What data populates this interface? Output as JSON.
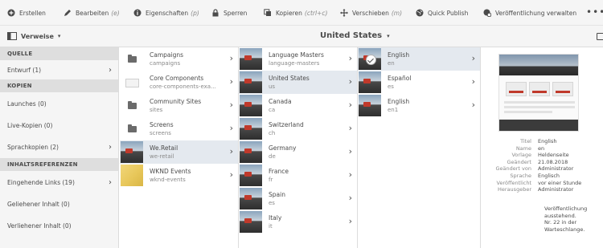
{
  "actions": [
    {
      "name": "create-action",
      "icon": "add-icon",
      "label": "Erstellen",
      "shortcut": ""
    },
    {
      "name": "edit-action",
      "icon": "pencil-icon",
      "label": "Bearbeiten",
      "shortcut": "(e)"
    },
    {
      "name": "properties-action",
      "icon": "info-icon",
      "label": "Eigenschaften",
      "shortcut": "(p)"
    },
    {
      "name": "lock-action",
      "icon": "lock-icon",
      "label": "Sperren",
      "shortcut": ""
    },
    {
      "name": "copy-action",
      "icon": "copy-icon",
      "label": "Kopieren",
      "shortcut": "(ctrl+c)"
    },
    {
      "name": "move-action",
      "icon": "move-icon",
      "label": "Verschieben",
      "shortcut": "(m)"
    },
    {
      "name": "quick-publish-action",
      "icon": "globe-icon",
      "label": "Quick Publish",
      "shortcut": ""
    },
    {
      "name": "manage-publication-action",
      "icon": "globe-gear-icon",
      "label": "Veröffentlichung verwalten",
      "shortcut": ""
    }
  ],
  "titlebar": {
    "rail_label": "Verweise",
    "title": "United States"
  },
  "rail": {
    "sections": [
      {
        "header": "QUELLE",
        "items": [
          {
            "label": "Entwurf (1)",
            "arrow": true
          }
        ]
      },
      {
        "header": "KOPIEN",
        "items": [
          {
            "label": "Launches (0)",
            "arrow": false
          },
          {
            "label": "Live-Kopien (0)",
            "arrow": false
          },
          {
            "label": "Sprachkopien (2)",
            "arrow": true
          }
        ]
      },
      {
        "header": "INHALTSREFERENZEN",
        "items": [
          {
            "label": "Eingehende Links (19)",
            "arrow": true
          },
          {
            "label": "Geliehener Inhalt (0)",
            "arrow": false
          },
          {
            "label": "Verliehener Inhalt (0)",
            "arrow": false
          }
        ]
      }
    ]
  },
  "columns": [
    [
      {
        "title": "Campaigns",
        "sub": "campaigns",
        "thumb": "folder",
        "selected": false
      },
      {
        "title": "Core Components",
        "sub": "core-components-exa...",
        "thumb": "component",
        "selected": false
      },
      {
        "title": "Community Sites",
        "sub": "sites",
        "thumb": "folder",
        "selected": false
      },
      {
        "title": "Screens",
        "sub": "screens",
        "thumb": "folder",
        "selected": false
      },
      {
        "title": "We.Retail",
        "sub": "we-retail",
        "thumb": "photo",
        "selected": true
      },
      {
        "title": "WKND Events",
        "sub": "wknd-events",
        "thumb": "photo-wk",
        "selected": false
      }
    ],
    [
      {
        "title": "Language Masters",
        "sub": "language-masters",
        "thumb": "photo",
        "selected": false
      },
      {
        "title": "United States",
        "sub": "us",
        "thumb": "photo",
        "selected": true
      },
      {
        "title": "Canada",
        "sub": "ca",
        "thumb": "photo",
        "selected": false
      },
      {
        "title": "Switzerland",
        "sub": "ch",
        "thumb": "photo",
        "selected": false
      },
      {
        "title": "Germany",
        "sub": "de",
        "thumb": "photo",
        "selected": false
      },
      {
        "title": "France",
        "sub": "fr",
        "thumb": "photo",
        "selected": false
      },
      {
        "title": "Spain",
        "sub": "es",
        "thumb": "photo",
        "selected": false
      },
      {
        "title": "Italy",
        "sub": "it",
        "thumb": "photo",
        "selected": false
      }
    ],
    [
      {
        "title": "English",
        "sub": "en",
        "thumb": "photo-check",
        "selected": true
      },
      {
        "title": "Español",
        "sub": "es",
        "thumb": "photo",
        "selected": false
      },
      {
        "title": "English",
        "sub": "en1",
        "thumb": "photo",
        "selected": false
      }
    ]
  ],
  "preview": {
    "meta": [
      {
        "key": "Titel",
        "value": "English"
      },
      {
        "key": "Name",
        "value": "en"
      },
      {
        "key": "Vorlage",
        "value": "Heldenseite"
      },
      {
        "key": "Geändert",
        "value": "21.08.2018"
      },
      {
        "key": "Geändert von",
        "value": "Administrator"
      },
      {
        "key": "Sprache",
        "value": "Englisch"
      },
      {
        "key": "Veröffentlicht",
        "value": "vor einer Stunde"
      },
      {
        "key": "Herausgeber",
        "value": "Administrator"
      }
    ],
    "status_lines": [
      "Veröffentlichung",
      "ausstehend.",
      "Nr. 22 in der",
      "Warteschlange."
    ]
  }
}
